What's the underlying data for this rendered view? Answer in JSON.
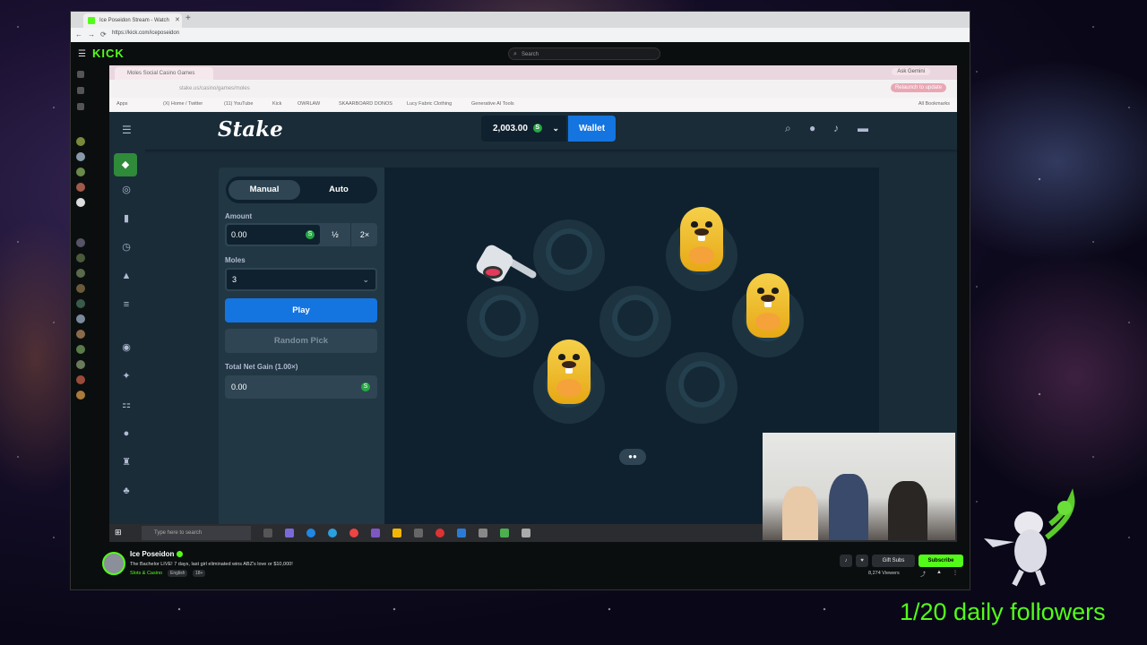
{
  "browser": {
    "tab_title": "Ice Poseidon Stream - Watch",
    "url": "https://kick.com/iceposeidon"
  },
  "kick": {
    "logo": "KICK",
    "search_placeholder": "Search"
  },
  "stream_browser": {
    "tab_title": "Moles Social Casino Games",
    "ask_gemini": "Ask Gemini",
    "url": "stake.us/casino/games/moles",
    "update_label": "Relaunch to update",
    "bookmarks": [
      "Apps",
      "(X) Home / Twitter",
      "(11) YouTube",
      "Kick",
      "OWRLAW",
      "SKAARBOARD DONOS",
      "Lucy Fabric Clothing",
      "Generative AI Tools"
    ],
    "all_bookmarks": "All Bookmarks"
  },
  "stake": {
    "logo": "Stake",
    "balance": "2,003.00",
    "wallet_label": "Wallet",
    "mode_manual": "Manual",
    "mode_auto": "Auto",
    "amount_label": "Amount",
    "amount_value": "0.00",
    "half_label": "½",
    "double_label": "2×",
    "moles_label": "Moles",
    "moles_value": "3",
    "play_label": "Play",
    "random_pick_label": "Random Pick",
    "net_gain_label": "Total Net Gain (1.00×)",
    "net_gain_value": "0.00",
    "coin_symbol": "S"
  },
  "taskbar": {
    "search_placeholder": "Type here to search"
  },
  "channel": {
    "name": "Ice Poseidon",
    "title": "The Bachelor LIVE! 7 days, last girl eliminated wins ABZ's love or $10,000!",
    "category": "Slots & Casino",
    "tags": [
      "English",
      "18+"
    ],
    "gift_subs_label": "Gift Subs",
    "subscribe_label": "Subscribe",
    "viewers": "8,274 Viewers"
  },
  "overlay": {
    "followers_text": "1/20 daily followers"
  },
  "colors": {
    "kick_green": "#53fc18",
    "stake_blue": "#1475e1",
    "stake_bg": "#1a2c38",
    "stake_panel": "#213743"
  }
}
